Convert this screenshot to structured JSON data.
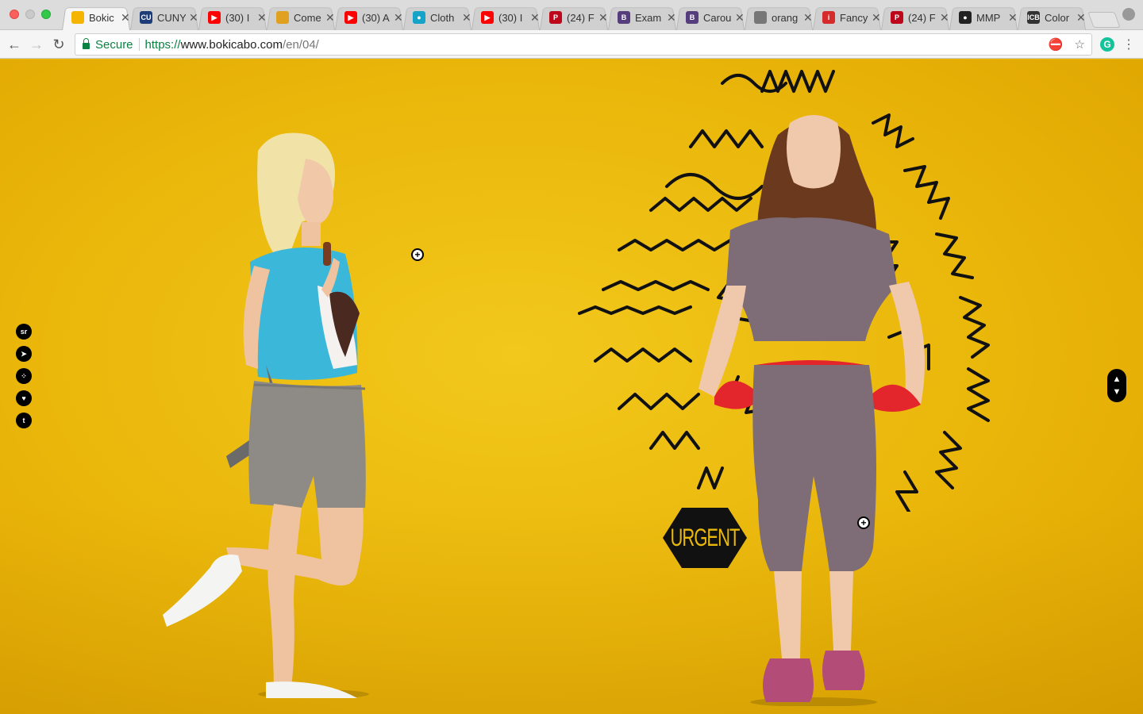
{
  "browser": {
    "tabs": [
      {
        "label": "Bokic",
        "favicon_color": "#f4b400",
        "favicon_text": "",
        "active": true
      },
      {
        "label": "CUNY",
        "favicon_color": "#1d3c78",
        "favicon_text": "CU"
      },
      {
        "label": "(30) I",
        "favicon_color": "#ff0000",
        "favicon_text": "▶"
      },
      {
        "label": "Come",
        "favicon_color": "#e0a020",
        "favicon_text": ""
      },
      {
        "label": "(30) A",
        "favicon_color": "#ff0000",
        "favicon_text": "▶"
      },
      {
        "label": "Cloth",
        "favicon_color": "#16a3c8",
        "favicon_text": "●"
      },
      {
        "label": "(30) I",
        "favicon_color": "#ff0000",
        "favicon_text": "▶"
      },
      {
        "label": "(24) F",
        "favicon_color": "#bd081c",
        "favicon_text": "P"
      },
      {
        "label": "Exam",
        "favicon_color": "#563d7c",
        "favicon_text": "B"
      },
      {
        "label": "Carou",
        "favicon_color": "#563d7c",
        "favicon_text": "B"
      },
      {
        "label": "orang",
        "favicon_color": "#777777",
        "favicon_text": ""
      },
      {
        "label": "Fancy",
        "favicon_color": "#d62b2b",
        "favicon_text": "i"
      },
      {
        "label": "(24) F",
        "favicon_color": "#bd081c",
        "favicon_text": "P"
      },
      {
        "label": "MMP",
        "favicon_color": "#222222",
        "favicon_text": "●"
      },
      {
        "label": "Color",
        "favicon_color": "#333333",
        "favicon_text": "ICB"
      }
    ],
    "tab_close": "✕",
    "address": {
      "secure_label": "Secure",
      "scheme": "https://",
      "host": "www.bokicabo.com",
      "path": "/en/04/"
    },
    "nav": {
      "back": "←",
      "forward": "→",
      "reload": "↻"
    },
    "grammarly": "G",
    "menu": "⋮",
    "star": "☆"
  },
  "page": {
    "social": [
      {
        "name": "sr",
        "label": "sr"
      },
      {
        "name": "cursor",
        "label": "➤"
      },
      {
        "name": "dots",
        "label": "⁘"
      },
      {
        "name": "heart",
        "label": "♥"
      },
      {
        "name": "twitter",
        "label": "t"
      }
    ],
    "nav_up": "▲",
    "nav_down": "▼",
    "badge_text": "URGENT",
    "hotspot_symbol": "+",
    "colors": {
      "background": "#e9b80a",
      "badge": "#111111"
    }
  }
}
